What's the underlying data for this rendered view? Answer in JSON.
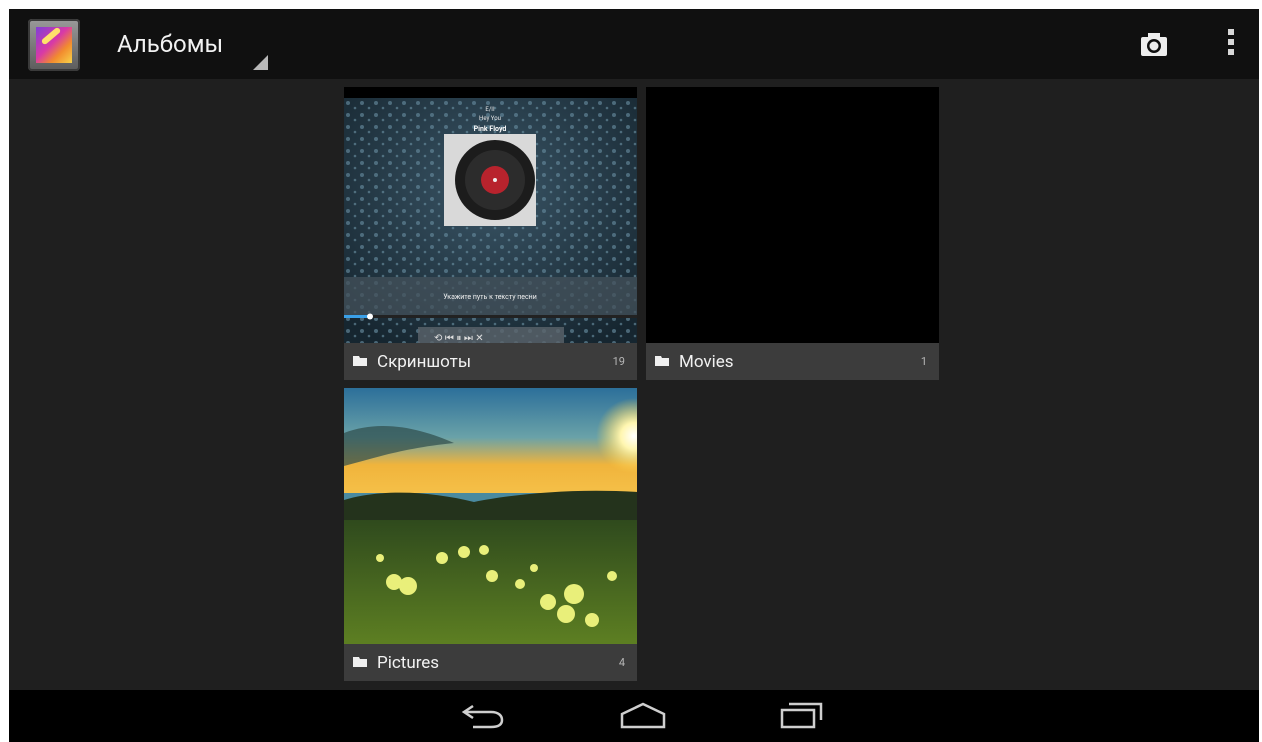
{
  "header": {
    "title": "Альбомы",
    "app_icon": "gallery-app-icon",
    "actions": [
      {
        "name": "camera-icon"
      },
      {
        "name": "overflow-menu-icon"
      }
    ]
  },
  "albums": [
    {
      "name": "Скриншоты",
      "count": "19",
      "thumb": {
        "line1": "E/II",
        "line2": "Hey You",
        "line3": "Pink Floyd",
        "lyrics": "Укажите путь к тексту песни"
      }
    },
    {
      "name": "Movies",
      "count": "1"
    },
    {
      "name": "Pictures",
      "count": "4"
    }
  ],
  "nav": [
    {
      "name": "back-icon"
    },
    {
      "name": "home-icon"
    },
    {
      "name": "recent-apps-icon"
    }
  ],
  "colors": {
    "actionbar": "#101010",
    "background": "#1f1f1f",
    "label_bar": "#414141",
    "navbar": "#000000"
  }
}
